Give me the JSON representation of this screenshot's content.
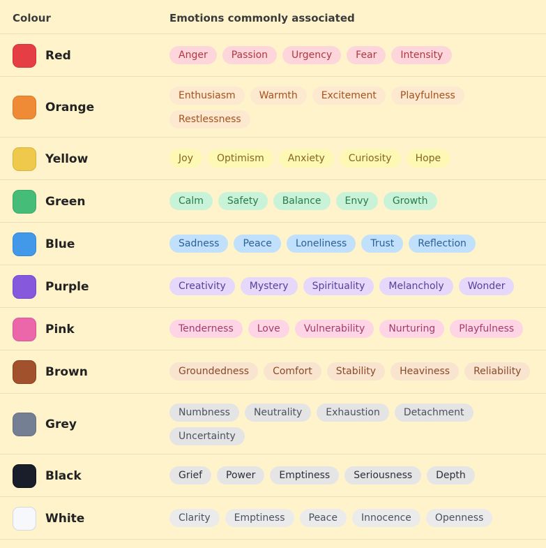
{
  "header": {
    "colour_label": "Colour",
    "emotions_label": "Emotions commonly associated"
  },
  "rows": [
    {
      "name": "Red",
      "swatch": "#e53e44",
      "swatch_border": "#d23338",
      "tag_bg": "#fdd6dc",
      "tag_text": "#b23642",
      "emotions": [
        "Anger",
        "Passion",
        "Urgency",
        "Fear",
        "Intensity"
      ]
    },
    {
      "name": "Orange",
      "swatch": "#ef8a37",
      "swatch_border": "#dc7a2a",
      "tag_bg": "#fde9cf",
      "tag_text": "#a5511c",
      "emotions": [
        "Enthusiasm",
        "Warmth",
        "Excitement",
        "Playfulness",
        "Restlessness"
      ]
    },
    {
      "name": "Yellow",
      "swatch": "#efc94c",
      "swatch_border": "#d9b43b",
      "tag_bg": "#fef8b5",
      "tag_text": "#866620",
      "emotions": [
        "Joy",
        "Optimism",
        "Anxiety",
        "Curiosity",
        "Hope"
      ]
    },
    {
      "name": "Green",
      "swatch": "#45bd79",
      "swatch_border": "#38a968",
      "tag_bg": "#c9f3d8",
      "tag_text": "#2a7a4c",
      "emotions": [
        "Calm",
        "Safety",
        "Balance",
        "Envy",
        "Growth"
      ]
    },
    {
      "name": "Blue",
      "swatch": "#4399e9",
      "swatch_border": "#3487d6",
      "tag_bg": "#c0e0fb",
      "tag_text": "#2c5f98",
      "emotions": [
        "Sadness",
        "Peace",
        "Loneliness",
        "Trust",
        "Reflection"
      ]
    },
    {
      "name": "Purple",
      "swatch": "#8659dc",
      "swatch_border": "#7449cb",
      "tag_bg": "#e6d8fb",
      "tag_text": "#5b3d9a",
      "emotions": [
        "Creativity",
        "Mystery",
        "Spirituality",
        "Melancholy",
        "Wonder"
      ]
    },
    {
      "name": "Pink",
      "swatch": "#eb67a9",
      "swatch_border": "#d95797",
      "tag_bg": "#fdd5e4",
      "tag_text": "#a53a6d",
      "emotions": [
        "Tenderness",
        "Love",
        "Vulnerability",
        "Nurturing",
        "Playfulness"
      ]
    },
    {
      "name": "Brown",
      "swatch": "#a1512b",
      "swatch_border": "#8c4320",
      "tag_bg": "#f9e4cf",
      "tag_text": "#8a4a2a",
      "emotions": [
        "Groundedness",
        "Comfort",
        "Stability",
        "Heaviness",
        "Reliability"
      ]
    },
    {
      "name": "Grey",
      "swatch": "#747f94",
      "swatch_border": "#666f82",
      "tag_bg": "#e4e4e4",
      "tag_text": "#4a5161",
      "emotions": [
        "Numbness",
        "Neutrality",
        "Exhaustion",
        "Detachment",
        "Uncertainty"
      ]
    },
    {
      "name": "Black",
      "swatch": "#1a1e2b",
      "swatch_border": "#10131c",
      "tag_bg": "#e5e5e5",
      "tag_text": "#2b2f3a",
      "emotions": [
        "Grief",
        "Power",
        "Emptiness",
        "Seriousness",
        "Depth"
      ]
    },
    {
      "name": "White",
      "swatch": "#f6f8fb",
      "swatch_border": "#d5d8de",
      "tag_bg": "#ebebeb",
      "tag_text": "#4a5161",
      "emotions": [
        "Clarity",
        "Emptiness",
        "Peace",
        "Innocence",
        "Openness"
      ]
    }
  ]
}
